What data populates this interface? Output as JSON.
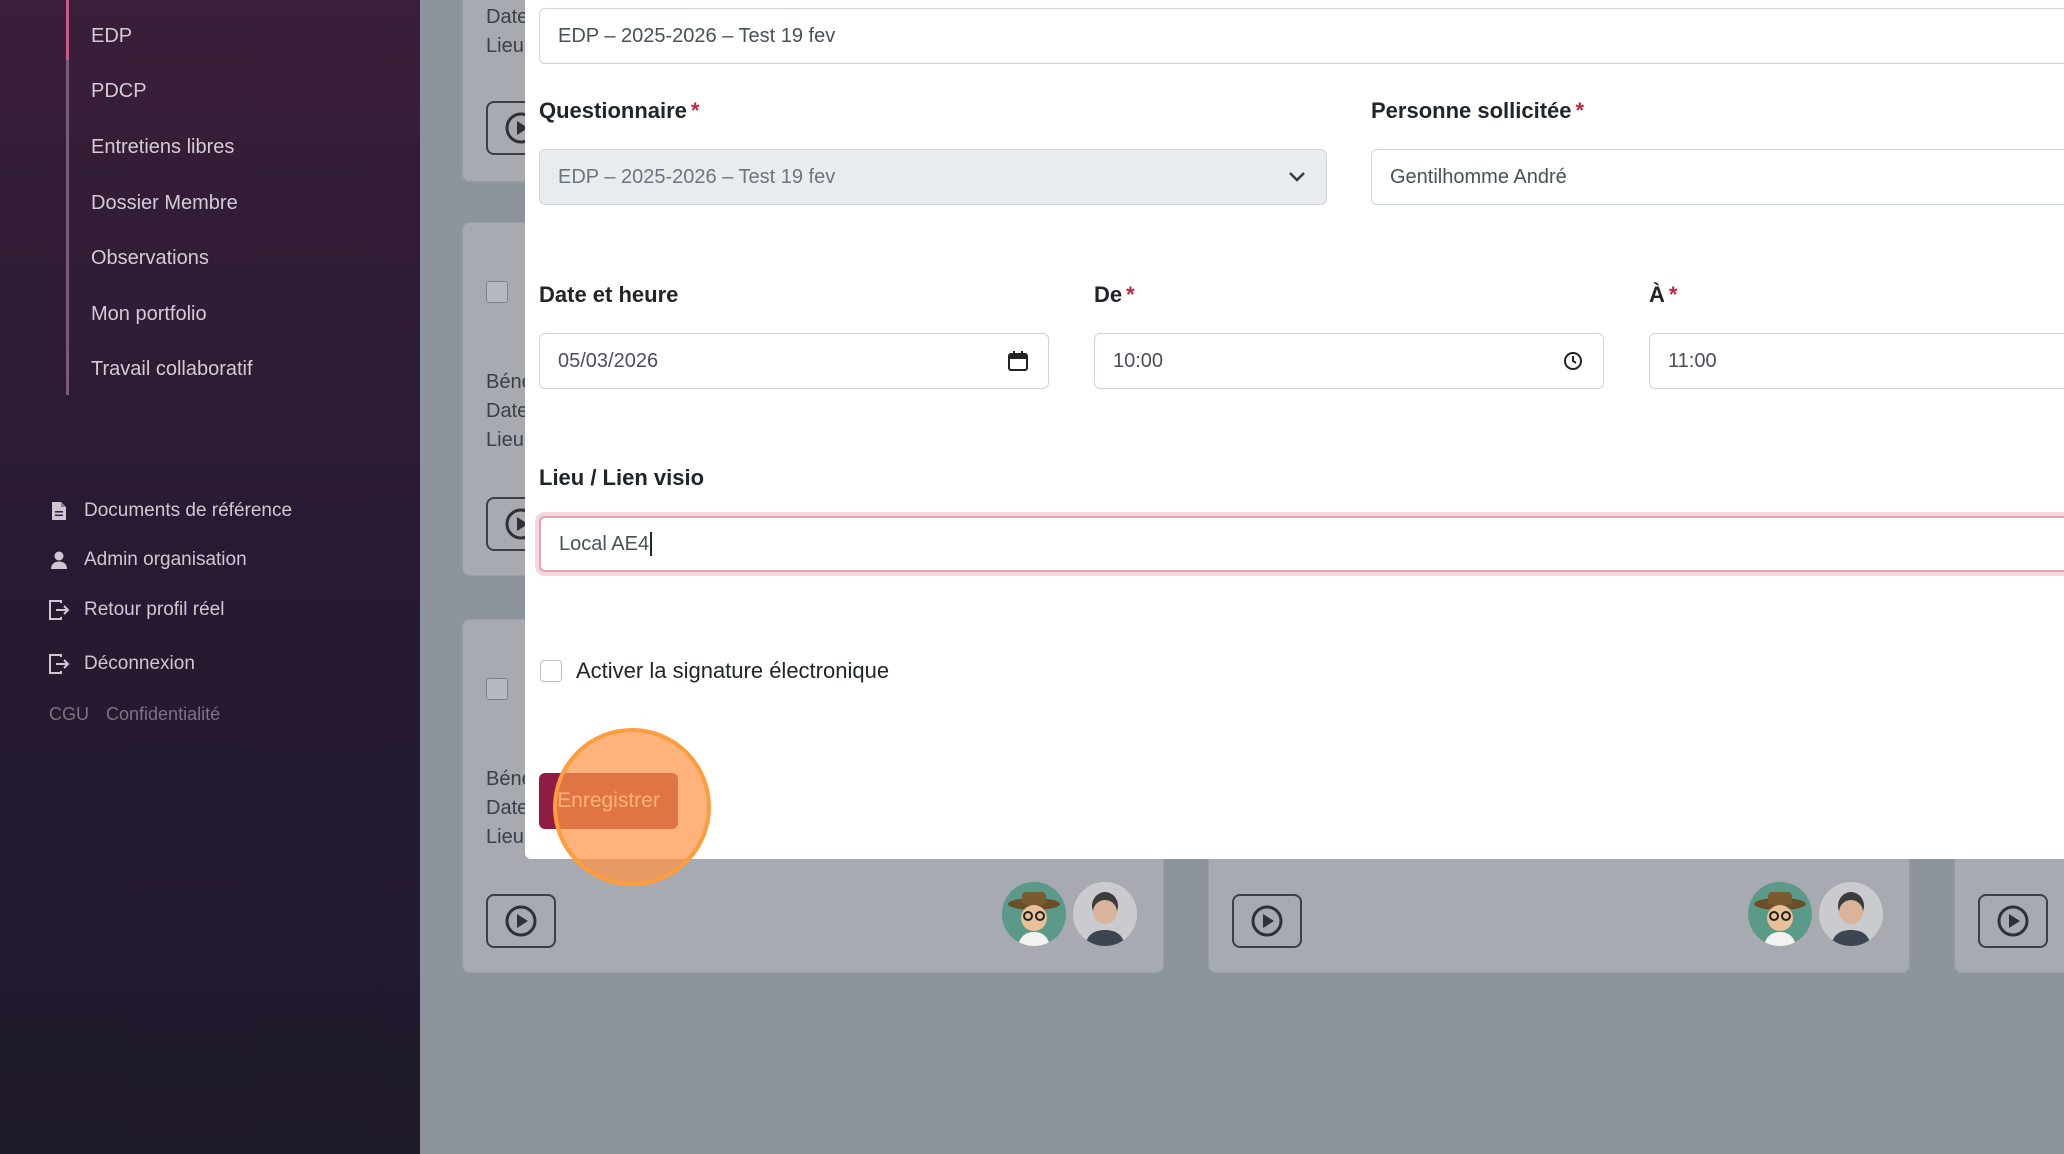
{
  "sidebar": {
    "nav": [
      "EDP",
      "PDCP",
      "Entretiens libres",
      "Dossier Membre",
      "Observations",
      "Mon portfolio",
      "Travail collaboratif"
    ],
    "bottom": [
      {
        "label": "Documents de référence",
        "icon": "document-icon"
      },
      {
        "label": "Admin organisation",
        "icon": "user-icon"
      },
      {
        "label": "Retour profil réel",
        "icon": "exit-icon"
      },
      {
        "label": "Déconnexion",
        "icon": "logout-icon"
      }
    ],
    "legal": {
      "cgu": "CGU",
      "privacy": "Confidentialité"
    }
  },
  "background": {
    "card1": {
      "lines": [
        "Date",
        "Lieu"
      ]
    },
    "card2": {
      "lines": [
        "Béné",
        "Date",
        "Lieu"
      ]
    },
    "card3": {
      "lines": [
        "Béné",
        "Date",
        "Lieu"
      ]
    }
  },
  "form": {
    "title_value": "EDP – 2025-2026 – Test 19 fev",
    "questionnaire": {
      "label": "Questionnaire",
      "required": "*",
      "value": "EDP – 2025-2026 – Test 19 fev"
    },
    "person": {
      "label": "Personne sollicitée",
      "required": "*",
      "value": "Gentilhomme André"
    },
    "date": {
      "label": "Date et heure",
      "value": "05/03/2026"
    },
    "from": {
      "label": "De",
      "required": "*",
      "value": "10:00"
    },
    "to": {
      "label": "À",
      "required": "*",
      "value": "11:00"
    },
    "location": {
      "label": "Lieu / Lien visio",
      "value": "Local AE4"
    },
    "esign": {
      "label": "Activer la signature électronique",
      "checked": false
    },
    "save_label": "Enregistrer"
  },
  "colors": {
    "accent": "#8f1d43",
    "required": "#c0263f",
    "click_highlight": "#ff9d3c"
  }
}
